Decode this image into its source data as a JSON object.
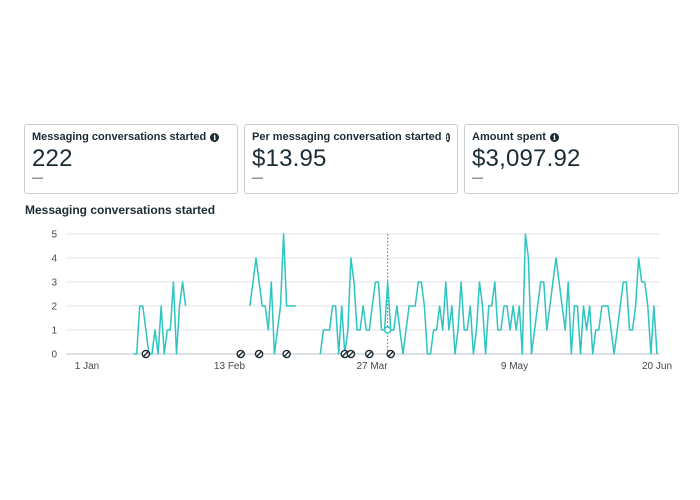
{
  "cards": [
    {
      "label": "Messaging conversations started",
      "value": "222",
      "delta": "—",
      "info_icon": "info-icon"
    },
    {
      "label": "Per messaging conversation started",
      "value": "$13.95",
      "delta": "—",
      "info_icon": "info-icon"
    },
    {
      "label": "Amount spent",
      "value": "$3,097.92",
      "delta": "—",
      "info_icon": "info-icon"
    }
  ],
  "chart": {
    "title": "Messaging conversations started"
  },
  "colors": {
    "line": "#2ec4c0",
    "grid": "#e4e6eb",
    "marker": "#1c2b33"
  },
  "chart_data": {
    "type": "line",
    "title": "Messaging conversations started",
    "x_tick_labels": [
      "1 Jan",
      "13 Feb",
      "27 Mar",
      "9 May",
      "20 Jun"
    ],
    "y_tick_labels": [
      "0",
      "1",
      "2",
      "3",
      "4",
      "5"
    ],
    "ylim": [
      0,
      5
    ],
    "grid": true,
    "series": [
      {
        "values": [
          null,
          null,
          null,
          null,
          null,
          null,
          null,
          null,
          null,
          null,
          0,
          0,
          2,
          2,
          1,
          0,
          0,
          1,
          0,
          2,
          0,
          1,
          1,
          3,
          0,
          2,
          3,
          2,
          null,
          null,
          null,
          null,
          null,
          null,
          null,
          null,
          null,
          null,
          null,
          null,
          null,
          null,
          null,
          null,
          null,
          null,
          null,
          null,
          2,
          3,
          4,
          3,
          2,
          2,
          1,
          3,
          0,
          1,
          2,
          5,
          2,
          2,
          2,
          2,
          null,
          null,
          null,
          null,
          null,
          null,
          null,
          0,
          1,
          1,
          1,
          2,
          2,
          0,
          2,
          0,
          1,
          4,
          3,
          1,
          1,
          2,
          1,
          1,
          2,
          3,
          3,
          1,
          1,
          3,
          1,
          1,
          2,
          1,
          0,
          1,
          2,
          2,
          2,
          3,
          3,
          2,
          0,
          0,
          1,
          1,
          2,
          1,
          3,
          1,
          2,
          0,
          1,
          3,
          1,
          1,
          2,
          0,
          1,
          3,
          2,
          0,
          2,
          2,
          3,
          1,
          1,
          2,
          2,
          1,
          2,
          1,
          2,
          0,
          5,
          4,
          0,
          1,
          2,
          3,
          3,
          1,
          2,
          3,
          4,
          3,
          2,
          1,
          3,
          0,
          2,
          2,
          0,
          2,
          1,
          2,
          0,
          1,
          1,
          2,
          2,
          2,
          1,
          0,
          1,
          2,
          3,
          3,
          1,
          1,
          2,
          4,
          3,
          3,
          2,
          0,
          2,
          0
        ]
      }
    ],
    "hover_marker": {
      "x_index": 93,
      "y": 1
    },
    "event_markers": [
      14,
      45,
      51,
      60,
      79,
      81,
      87,
      94
    ]
  }
}
